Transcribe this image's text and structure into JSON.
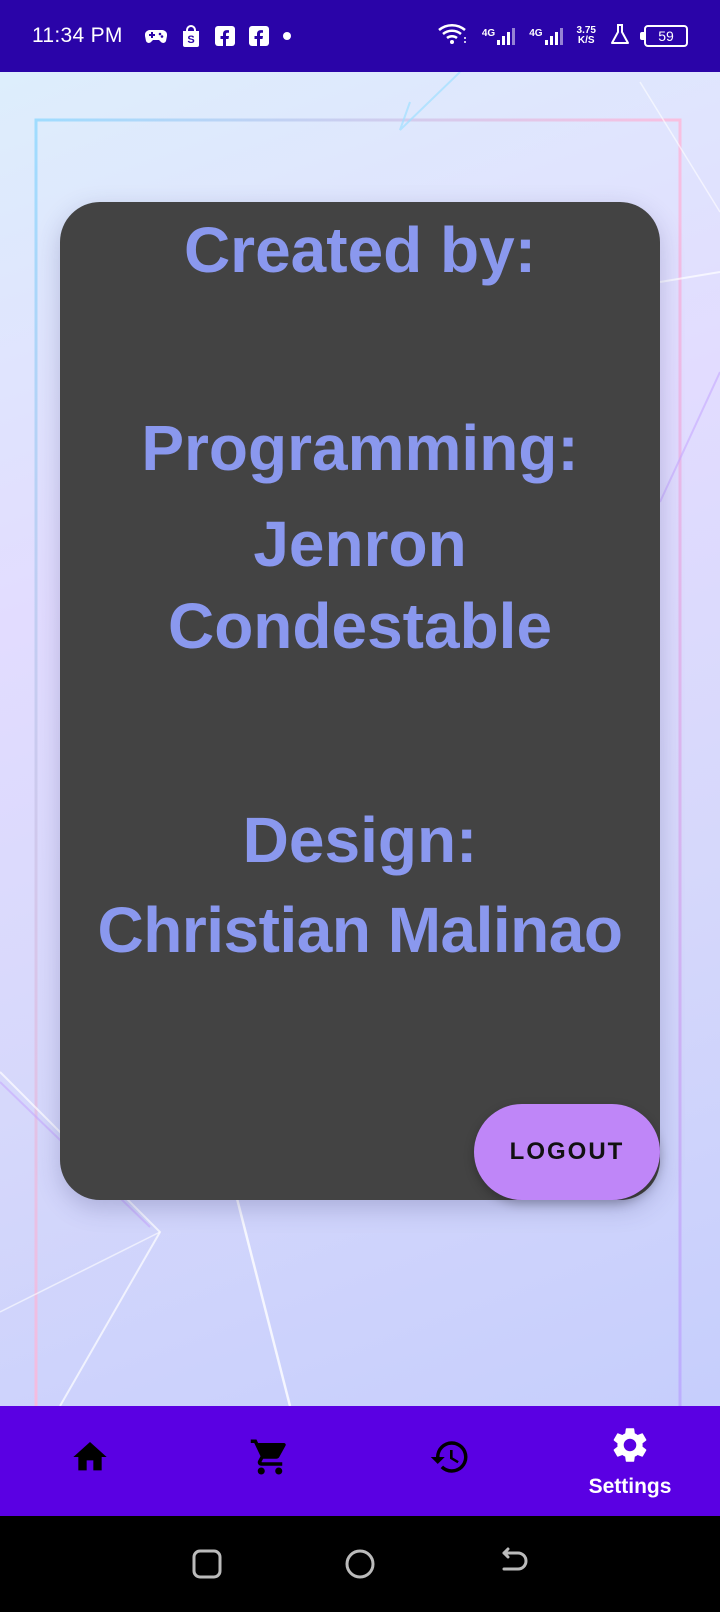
{
  "status_bar": {
    "time": "11:34 PM",
    "network_1": "4G",
    "network_2": "4G",
    "speed_value": "3.75",
    "speed_unit": "K/S",
    "battery": "59",
    "icons": [
      "game-controller-icon",
      "shopping-bag-icon",
      "facebook-icon",
      "facebook-icon",
      "dot-icon",
      "wifi-icon",
      "signal-icon",
      "signal-icon",
      "flask-icon",
      "battery-icon"
    ]
  },
  "card": {
    "heading": "Created by:",
    "programming_label": "Programming:",
    "programmer_first": "Jenron",
    "programmer_last": "Condestable",
    "design_label": "Design:",
    "designer": "Christian Malinao",
    "logout_label": "LOGOUT",
    "background_color": "#434343",
    "text_color": "#8a98ee",
    "logout_color": "#bf86f8"
  },
  "bottom_nav": {
    "background_color": "#5a00e3",
    "items": [
      {
        "icon": "home-icon",
        "label": ""
      },
      {
        "icon": "cart-icon",
        "label": ""
      },
      {
        "icon": "history-icon",
        "label": ""
      },
      {
        "icon": "settings-icon",
        "label": "Settings",
        "active": true
      }
    ]
  },
  "system_nav": {
    "icons": [
      "recents-icon",
      "home-circle-icon",
      "back-icon"
    ]
  }
}
